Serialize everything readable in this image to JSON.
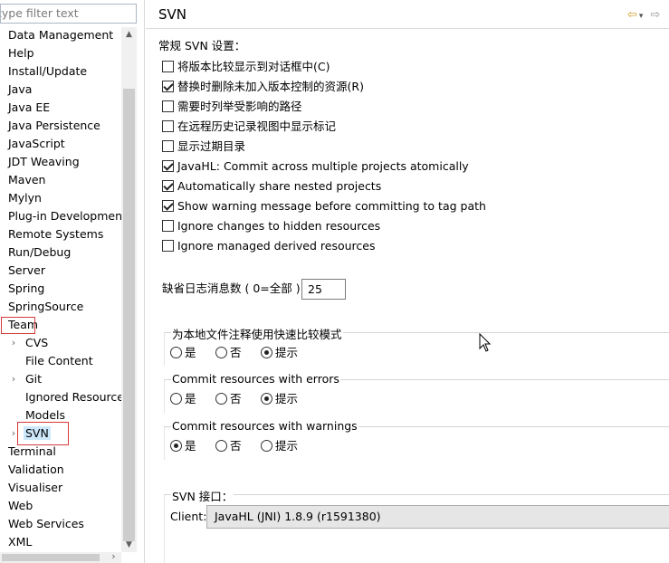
{
  "sidebar": {
    "filter_placeholder": "type filter text",
    "items": [
      {
        "label": "Data Management"
      },
      {
        "label": "Help"
      },
      {
        "label": "Install/Update"
      },
      {
        "label": "Java"
      },
      {
        "label": "Java EE"
      },
      {
        "label": "Java Persistence"
      },
      {
        "label": "JavaScript"
      },
      {
        "label": "JDT Weaving"
      },
      {
        "label": "Maven"
      },
      {
        "label": "Mylyn"
      },
      {
        "label": "Plug-in Development"
      },
      {
        "label": "Remote Systems"
      },
      {
        "label": "Run/Debug"
      },
      {
        "label": "Server"
      },
      {
        "label": "Spring"
      },
      {
        "label": "SpringSource"
      },
      {
        "label": "Team"
      },
      {
        "label": "CVS"
      },
      {
        "label": "File Content"
      },
      {
        "label": "Git"
      },
      {
        "label": "Ignored Resources"
      },
      {
        "label": "Models"
      },
      {
        "label": "SVN"
      },
      {
        "label": "Terminal"
      },
      {
        "label": "Validation"
      },
      {
        "label": "Visualiser"
      },
      {
        "label": "Web"
      },
      {
        "label": "Web Services"
      },
      {
        "label": "XML"
      }
    ],
    "twisty_icon": "›"
  },
  "header": {
    "title": "SVN",
    "back_icon": "⇦",
    "dropdown_icon": "▾",
    "forward_icon": "⇨"
  },
  "general": {
    "section_label": "常规 SVN 设置：",
    "checkboxes": [
      {
        "label": "将版本比较显示到对话框中(C)",
        "checked": false
      },
      {
        "label": "替换时删除未加入版本控制的资源(R)",
        "checked": true
      },
      {
        "label": "需要时列举受影响的路径",
        "checked": false
      },
      {
        "label": "在远程历史记录视图中显示标记",
        "checked": false
      },
      {
        "label": "显示过期目录",
        "checked": false
      },
      {
        "label": "JavaHL: Commit across multiple projects atomically",
        "checked": true
      },
      {
        "label": "Automatically share nested projects",
        "checked": true
      },
      {
        "label": "Show warning message before committing to tag path",
        "checked": true
      },
      {
        "label": "Ignore changes to hidden resources",
        "checked": false
      },
      {
        "label": "Ignore managed derived resources",
        "checked": false
      }
    ]
  },
  "log": {
    "label": "缺省日志消息数 ( 0=全部 )",
    "value": "25"
  },
  "groups": [
    {
      "title": "为本地文件注释使用快速比较模式",
      "options": [
        {
          "label": "是",
          "selected": false
        },
        {
          "label": "否",
          "selected": false
        },
        {
          "label": "提示",
          "selected": true
        }
      ]
    },
    {
      "title": "Commit resources with errors",
      "options": [
        {
          "label": "是",
          "selected": false
        },
        {
          "label": "否",
          "selected": false
        },
        {
          "label": "提示",
          "selected": true
        }
      ]
    },
    {
      "title": "Commit resources with warnings",
      "options": [
        {
          "label": "是",
          "selected": true
        },
        {
          "label": "否",
          "selected": false
        },
        {
          "label": "提示",
          "selected": false
        }
      ]
    }
  ],
  "svn_interface": {
    "title": "SVN 接口：",
    "client_label": "Client:",
    "client_value": "JavaHL (JNI) 1.8.9 (r1591380)"
  },
  "scroll_arrows": {
    "up": "▲",
    "down": "▼",
    "right": "›"
  }
}
